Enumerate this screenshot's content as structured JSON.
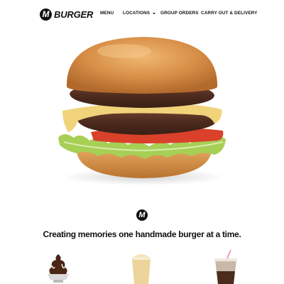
{
  "brand": {
    "logo_letter": "M",
    "name": "BURGER"
  },
  "nav": {
    "items": [
      {
        "label": "MENU"
      },
      {
        "label": "LOCATIONS"
      },
      {
        "label": "GROUP ORDERS"
      },
      {
        "label": "CARRY OUT & DELIVERY"
      }
    ]
  },
  "hero": {
    "image": "cheeseburger-photo"
  },
  "section": {
    "logo_letter": "M",
    "tagline": "Creating memories one handmade burger at a time."
  },
  "products": [
    {
      "image": "chocolate-sundae-photo"
    },
    {
      "image": "milkshake-photo"
    },
    {
      "image": "soda-cup-photo"
    }
  ],
  "colors": {
    "text": "#111111",
    "background": "#ffffff",
    "bun": "#d08a46",
    "patty": "#5a3323",
    "cheese": "#f1d37a",
    "tomato": "#d9412b",
    "lettuce": "#a6cf55"
  }
}
